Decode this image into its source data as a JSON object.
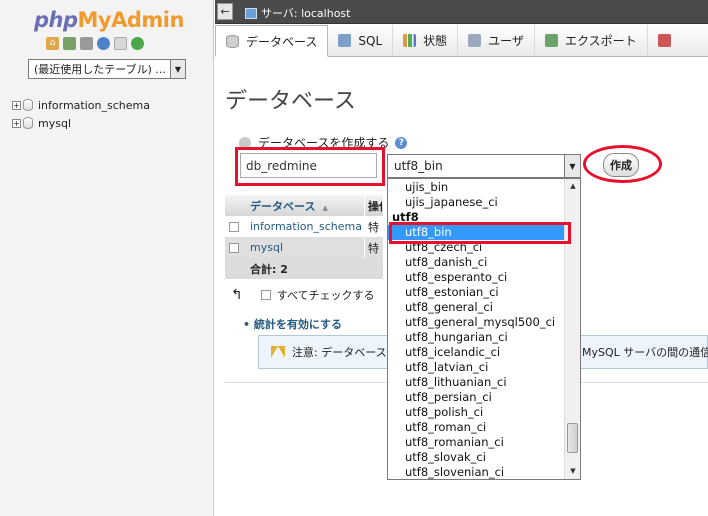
{
  "logo": {
    "php": "php",
    "my": "My",
    "admin": "Admin"
  },
  "nav_icons": [
    "home-icon",
    "log-icon",
    "query-icon",
    "docs-icon",
    "copy-icon",
    "reload-icon"
  ],
  "left": {
    "recent_tables": "(最近使用したテーブル) ...",
    "tree": [
      {
        "name": "information_schema"
      },
      {
        "name": "mysql"
      }
    ]
  },
  "topbar": {
    "back": "←",
    "breadcrumb": "サーバ: localhost"
  },
  "tabs": [
    {
      "label": "データベース",
      "icon": "database-icon",
      "active": true
    },
    {
      "label": "SQL",
      "icon": "sql-icon"
    },
    {
      "label": "状態",
      "icon": "status-icon"
    },
    {
      "label": "ユーザ",
      "icon": "users-icon"
    },
    {
      "label": "エクスポート",
      "icon": "export-icon"
    }
  ],
  "page_title": "データベース",
  "create": {
    "label": "データベースを作成する",
    "help": "?",
    "db_name": "db_redmine",
    "collation": "utf8_bin",
    "button": "作成"
  },
  "db_table": {
    "header_name": "データベース",
    "header_op": "操作",
    "rows": [
      {
        "name": "information_schema",
        "op": "特"
      },
      {
        "name": "mysql",
        "op": "特"
      }
    ],
    "total_label": "合計: 2"
  },
  "check_all": "すべてチェックする",
  "stats_link": "統計を有効にする",
  "notice": {
    "part1": "注意: データベース",
    "part2": "MySQL サーバの間の通信"
  },
  "dropdown": {
    "items": [
      {
        "label": "ujis_bin",
        "type": "option"
      },
      {
        "label": "ujis_japanese_ci",
        "type": "option"
      },
      {
        "label": "utf8",
        "type": "group"
      },
      {
        "label": "utf8_bin",
        "type": "option",
        "selected": true
      },
      {
        "label": "utf8_czech_ci",
        "type": "option"
      },
      {
        "label": "utf8_danish_ci",
        "type": "option"
      },
      {
        "label": "utf8_esperanto_ci",
        "type": "option"
      },
      {
        "label": "utf8_estonian_ci",
        "type": "option"
      },
      {
        "label": "utf8_general_ci",
        "type": "option"
      },
      {
        "label": "utf8_general_mysql500_ci",
        "type": "option"
      },
      {
        "label": "utf8_hungarian_ci",
        "type": "option"
      },
      {
        "label": "utf8_icelandic_ci",
        "type": "option"
      },
      {
        "label": "utf8_latvian_ci",
        "type": "option"
      },
      {
        "label": "utf8_lithuanian_ci",
        "type": "option"
      },
      {
        "label": "utf8_persian_ci",
        "type": "option"
      },
      {
        "label": "utf8_polish_ci",
        "type": "option"
      },
      {
        "label": "utf8_roman_ci",
        "type": "option"
      },
      {
        "label": "utf8_romanian_ci",
        "type": "option"
      },
      {
        "label": "utf8_slovak_ci",
        "type": "option"
      },
      {
        "label": "utf8_slovenian_ci",
        "type": "option"
      }
    ]
  },
  "colors": {
    "highlight": "#e8112d",
    "selection": "#3399ff",
    "link": "#235a81",
    "topbar": "#4a4a4a"
  }
}
